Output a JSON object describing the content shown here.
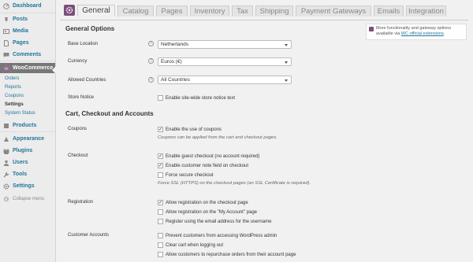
{
  "sidebar": {
    "items": [
      {
        "label": "Dashboard",
        "icon": "dashboard-icon"
      },
      {
        "label": "Posts",
        "icon": "pin-icon"
      },
      {
        "label": "Media",
        "icon": "media-icon"
      },
      {
        "label": "Pages",
        "icon": "page-icon"
      },
      {
        "label": "Comments",
        "icon": "comment-icon"
      },
      {
        "label": "WooCommerce",
        "icon": "woocommerce-icon"
      },
      {
        "label": "Products",
        "icon": "products-icon"
      },
      {
        "label": "Appearance",
        "icon": "appearance-icon"
      },
      {
        "label": "Plugins",
        "icon": "plugins-icon"
      },
      {
        "label": "Users",
        "icon": "users-icon"
      },
      {
        "label": "Tools",
        "icon": "tools-icon"
      },
      {
        "label": "Settings",
        "icon": "settings-icon"
      }
    ],
    "woo_submenu": [
      "Orders",
      "Reports",
      "Coupons",
      "Settings",
      "System Status"
    ],
    "collapse_label": "Collapse menu"
  },
  "tabs": [
    "General",
    "Catalog",
    "Pages",
    "Inventory",
    "Tax",
    "Shipping",
    "Payment Gateways",
    "Emails",
    "Integration"
  ],
  "notice": {
    "text": "More functionality and gateway options available via ",
    "link": "WC official extensions",
    "end": "."
  },
  "general_options": {
    "heading": "General Options",
    "base_location": {
      "label": "Base Location",
      "value": "Netherlands"
    },
    "currency": {
      "label": "Currency",
      "value": "Euros (€)"
    },
    "allowed_countries": {
      "label": "Allowed Countries",
      "value": "All Countries"
    },
    "store_notice": {
      "label": "Store Notice",
      "checkbox": "Enable site-wide store notice text",
      "checked": false
    }
  },
  "cart_checkout": {
    "heading": "Cart, Checkout and Accounts",
    "coupons": {
      "label": "Coupons",
      "checkbox": "Enable the use of coupons",
      "checked": true,
      "desc": "Coupons can be applied from the cart and checkout pages."
    },
    "checkout": {
      "label": "Checkout",
      "options": [
        {
          "text": "Enable guest checkout (no account required)",
          "checked": true
        },
        {
          "text": "Enable customer note field on checkout",
          "checked": true
        },
        {
          "text": "Force secure checkout",
          "checked": false
        }
      ],
      "desc": "Force SSL (HTTPS) on the checkout pages (an SSL Certificate is required)."
    },
    "registration": {
      "label": "Registration",
      "options": [
        {
          "text": "Allow registration on the checkout page",
          "checked": true
        },
        {
          "text": "Allow registration on the \"My Account\" page",
          "checked": false
        },
        {
          "text": "Register using the email address for the username",
          "checked": false
        }
      ]
    },
    "customer_accounts": {
      "label": "Customer Accounts",
      "options": [
        {
          "text": "Prevent customers from accessing WordPress admin",
          "checked": false
        },
        {
          "text": "Clear cart when logging out",
          "checked": false
        },
        {
          "text": "Allow customers to repurchase orders from their account page",
          "checked": false
        }
      ]
    }
  },
  "colors": {
    "link": "#21759b",
    "woo_purple": "#7b4f7b",
    "active_menu": "#777777"
  }
}
